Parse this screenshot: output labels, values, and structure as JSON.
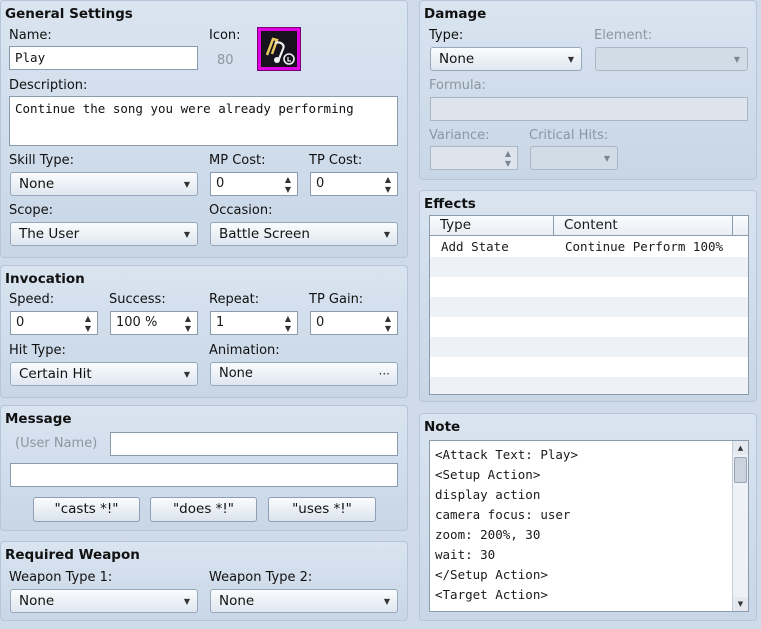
{
  "general": {
    "title": "General Settings",
    "name_label": "Name:",
    "name_value": "Play",
    "icon_label": "Icon:",
    "icon_index": "80",
    "desc_label": "Description:",
    "desc_value": "Continue the song you were already performing",
    "skill_type_label": "Skill Type:",
    "skill_type_value": "None",
    "mp_label": "MP Cost:",
    "mp_value": "0",
    "tp_label": "TP Cost:",
    "tp_value": "0",
    "scope_label": "Scope:",
    "scope_value": "The User",
    "occasion_label": "Occasion:",
    "occasion_value": "Battle Screen"
  },
  "invocation": {
    "title": "Invocation",
    "speed_label": "Speed:",
    "speed_value": "0",
    "success_label": "Success:",
    "success_value": "100 %",
    "repeat_label": "Repeat:",
    "repeat_value": "1",
    "tpgain_label": "TP Gain:",
    "tpgain_value": "0",
    "hit_type_label": "Hit Type:",
    "hit_type_value": "Certain Hit",
    "animation_label": "Animation:",
    "animation_value": "None",
    "animation_button": "···"
  },
  "message": {
    "title": "Message",
    "user_name_label": "(User Name)",
    "line1_value": "",
    "line2_value": "",
    "casts_button": "\"casts *!\"",
    "does_button": "\"does *!\"",
    "uses_button": "\"uses *!\""
  },
  "required_weapon": {
    "title": "Required Weapon",
    "type1_label": "Weapon Type 1:",
    "type1_value": "None",
    "type2_label": "Weapon Type 2:",
    "type2_value": "None"
  },
  "damage": {
    "title": "Damage",
    "type_label": "Type:",
    "type_value": "None",
    "element_label": "Element:",
    "element_value": "",
    "formula_label": "Formula:",
    "formula_value": "",
    "variance_label": "Variance:",
    "variance_value": "",
    "critical_label": "Critical Hits:",
    "critical_value": ""
  },
  "effects": {
    "title": "Effects",
    "col_type": "Type",
    "col_content": "Content",
    "rows": [
      {
        "type": "Add State",
        "content": "Continue Perform 100%"
      }
    ]
  },
  "note": {
    "title": "Note",
    "lines": [
      "<Attack Text: Play>",
      "<Setup Action>",
      "display action",
      "camera focus: user",
      "zoom: 200%, 30",
      "wait: 30",
      "</Setup Action>",
      "<Target Action>"
    ]
  },
  "colors": {
    "icon_frame": "#e000e0",
    "panel_bg": "#d9e4f0"
  }
}
